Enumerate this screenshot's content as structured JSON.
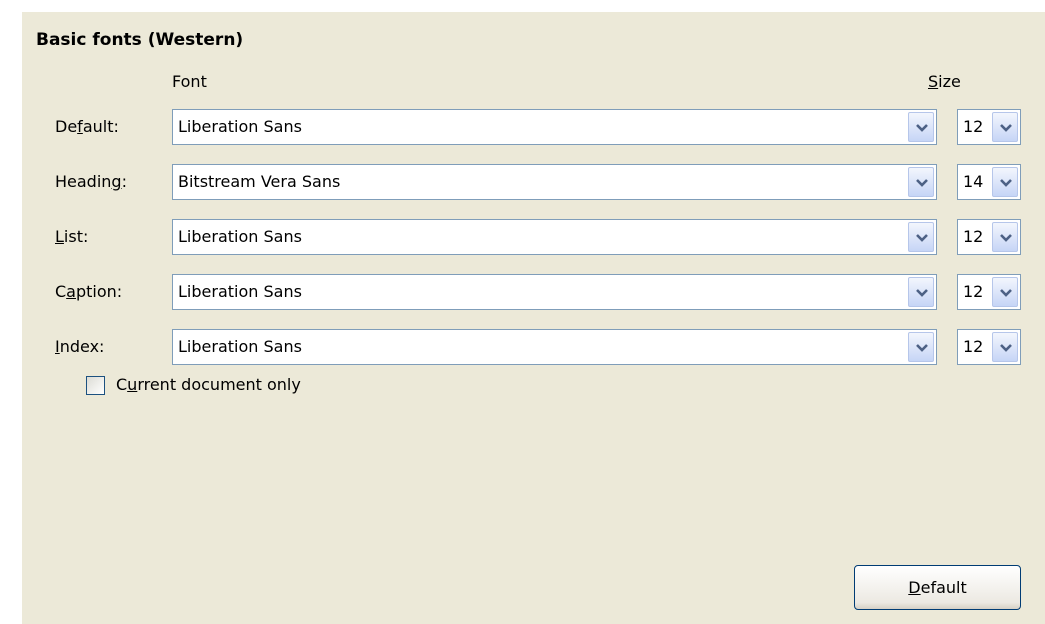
{
  "section": {
    "title": "Basic fonts (Western)"
  },
  "columns": {
    "font": "Font",
    "size": {
      "mnemonic": "S",
      "rest": "ize"
    }
  },
  "rows": [
    {
      "label": {
        "before": "De",
        "mnemonic": "f",
        "after": "ault:"
      },
      "font": "Liberation Sans",
      "size": "12"
    },
    {
      "label": {
        "before": "Headin",
        "mnemonic": "g",
        "after": ":"
      },
      "font": "Bitstream Vera Sans",
      "size": "14"
    },
    {
      "label": {
        "before": "",
        "mnemonic": "L",
        "after": "ist:"
      },
      "font": "Liberation Sans",
      "size": "12"
    },
    {
      "label": {
        "before": "C",
        "mnemonic": "a",
        "after": "ption:"
      },
      "font": "Liberation Sans",
      "size": "12"
    },
    {
      "label": {
        "before": "",
        "mnemonic": "I",
        "after": "ndex:"
      },
      "font": "Liberation Sans",
      "size": "12"
    }
  ],
  "current_document_only": {
    "before": "C",
    "mnemonic": "u",
    "after": "rrent document only",
    "checked": false
  },
  "default_button": {
    "mnemonic": "D",
    "rest": "efault"
  },
  "icons": {
    "dropdown": "chevron-down-icon"
  },
  "colors": {
    "panel_background": "#ece9d8",
    "field_border": "#7f9db9",
    "button_border": "#003c74",
    "arrow": "#4d6185"
  }
}
